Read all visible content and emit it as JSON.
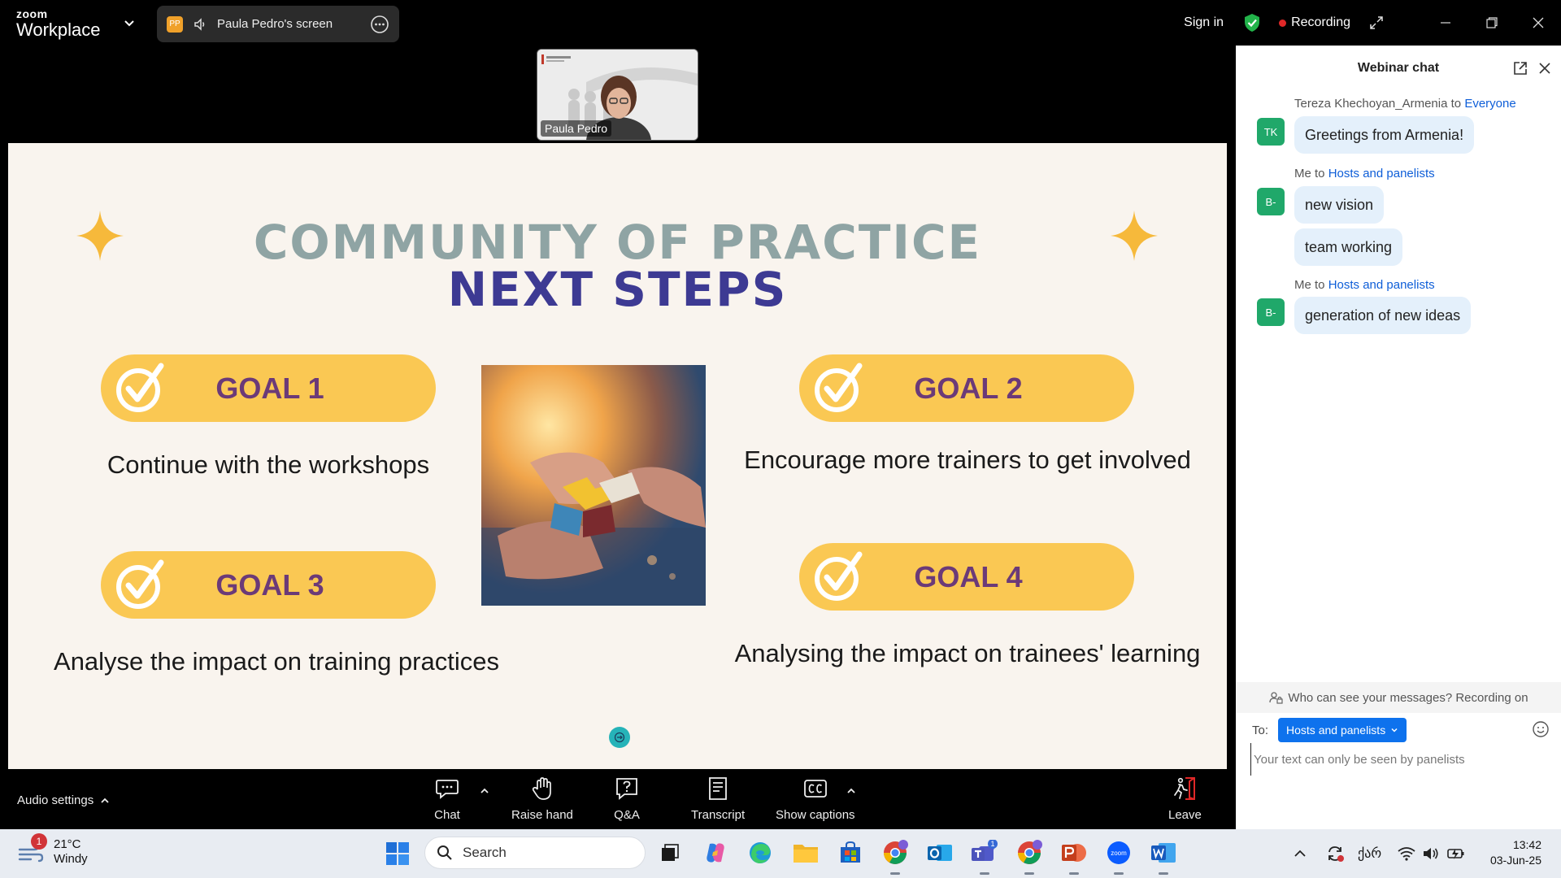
{
  "app": {
    "brand_top": "zoom",
    "brand_bottom": "Workplace",
    "screen_avatar": "PP",
    "screen_label": "Paula Pedro's screen",
    "sign_in": "Sign in",
    "recording": "Recording"
  },
  "video": {
    "participant_name": "Paula Pedro"
  },
  "slide": {
    "title_line1": "COMMUNITY OF PRACTICE",
    "title_line2": "NEXT STEPS",
    "goals": [
      {
        "label": "GOAL 1",
        "text": "Continue with the workshops"
      },
      {
        "label": "GOAL 2",
        "text": "Encourage more trainers to get involved"
      },
      {
        "label": "GOAL 3",
        "text": "Analyse the impact on training practices"
      },
      {
        "label": "GOAL 4",
        "text": "Analysing the impact on trainees' learning"
      }
    ],
    "colors": {
      "background": "#f9f4ee",
      "title_grey": "#8fa4a4",
      "title_blue": "#3d3a93",
      "goal_pill": "#fac853",
      "goal_text": "#6b3a78",
      "sparkle": "#f6b93b"
    }
  },
  "controls": {
    "audio_settings": "Audio settings",
    "chat": "Chat",
    "raise_hand": "Raise hand",
    "qa": "Q&A",
    "transcript": "Transcript",
    "show_captions": "Show captions",
    "leave": "Leave"
  },
  "chat": {
    "title": "Webinar chat",
    "messages": [
      {
        "sender": "Tereza Khechoyan_Armenia",
        "to_word": "to",
        "target": "Everyone",
        "avatar": "TK",
        "bubbles": [
          "Greetings from Armenia!"
        ]
      },
      {
        "sender": "Me",
        "to_word": "to",
        "target": "Hosts and panelists",
        "avatar": "B-",
        "bubbles": [
          "new vision",
          "team working"
        ]
      },
      {
        "sender": "Me",
        "to_word": "to",
        "target": "Hosts and panelists",
        "avatar": "B-",
        "bubbles": [
          "generation of new ideas"
        ]
      }
    ],
    "privacy_notice": "Who can see your messages? Recording on",
    "to_label": "To:",
    "to_selected": "Hosts and panelists",
    "input_placeholder": "Your text can only be seen by panelists"
  },
  "taskbar": {
    "weather_badge": "1",
    "temperature": "21°C",
    "condition": "Windy",
    "search_placeholder": "Search",
    "teams_badge": "1",
    "language": "ქარ",
    "time": "13:42",
    "date": "03-Jun-25"
  },
  "icons": [
    "chevron-down-icon",
    "speaker-icon",
    "more-icon",
    "shield-icon",
    "expand-icon",
    "minimize-icon",
    "restore-icon",
    "close-icon",
    "chat-icon",
    "hand-icon",
    "qa-icon",
    "transcript-icon",
    "cc-icon",
    "leave-icon",
    "popout-icon",
    "person-lock-icon",
    "emoji-icon",
    "windows-start-icon",
    "search-icon"
  ]
}
